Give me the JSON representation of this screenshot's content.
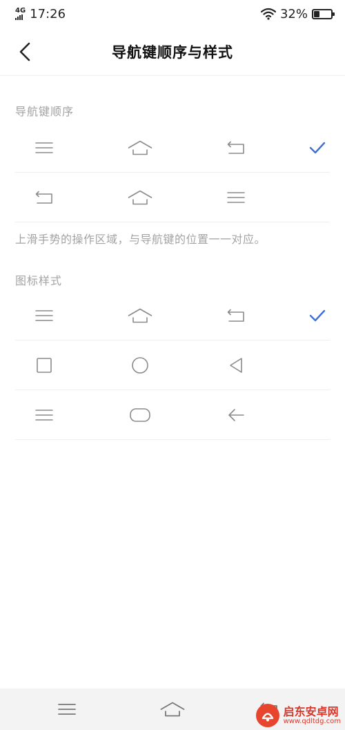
{
  "status_bar": {
    "network": "4G",
    "time": "17:26",
    "battery_percent": "32%",
    "battery_level": 0.32
  },
  "header": {
    "title": "导航键顺序与样式",
    "back_icon": "chevron-left-icon"
  },
  "order_section": {
    "title": "导航键顺序",
    "options": [
      {
        "icons": [
          "menu-icon",
          "home-icon",
          "back-return-icon"
        ],
        "selected": true
      },
      {
        "icons": [
          "back-return-icon",
          "home-icon",
          "menu-icon"
        ],
        "selected": false
      }
    ],
    "note": "上滑手势的操作区域，与导航键的位置一一对应。"
  },
  "style_section": {
    "title": "图标样式",
    "options": [
      {
        "icons": [
          "menu-icon",
          "home-icon",
          "back-return-icon"
        ],
        "selected": true
      },
      {
        "icons": [
          "square-icon",
          "circle-icon",
          "triangle-back-icon"
        ],
        "selected": false
      },
      {
        "icons": [
          "menu-icon",
          "pill-home-icon",
          "arrow-left-icon"
        ],
        "selected": false
      }
    ]
  },
  "nav_bar": {
    "icons": [
      "menu-icon",
      "home-icon",
      "back-return-icon"
    ]
  },
  "watermark": {
    "name": "启东安卓网",
    "url": "www.qdltdg.com"
  },
  "colors": {
    "accent": "#3f6fd6",
    "icon": "#8a8a8a",
    "section_text": "#a3a3a3",
    "divider": "#eeeeee",
    "nav_bar_bg": "#f3f3f3"
  }
}
